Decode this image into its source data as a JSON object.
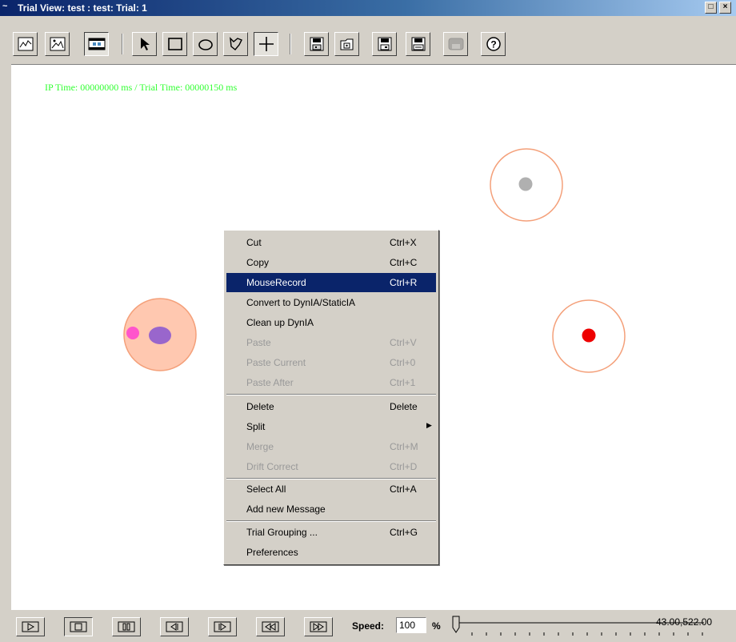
{
  "window": {
    "title": "Trial View: test : test: Trial: 1",
    "app_icon": "signal-wave-icon",
    "restore_glyph": "□",
    "close_glyph": "×"
  },
  "toolbar": {
    "tools": [
      {
        "name": "line-chart-icon"
      },
      {
        "name": "image-view-icon"
      },
      {
        "name": "animation-view-icon",
        "pressed": true
      },
      {
        "name": "pointer-icon"
      },
      {
        "name": "rectangle-icon"
      },
      {
        "name": "ellipse-icon"
      },
      {
        "name": "freehand-icon"
      },
      {
        "name": "crosshair-icon"
      },
      {
        "name": "save-ia-icon"
      },
      {
        "name": "open-ia-icon"
      },
      {
        "name": "save-ia-alt-icon"
      },
      {
        "name": "save-all-icon"
      },
      {
        "name": "disabled-tool-icon",
        "disabled": true
      },
      {
        "name": "help-icon"
      }
    ]
  },
  "canvas": {
    "time_label": "IP Time: 00000000 ms  /  Trial Time: 00000150 ms"
  },
  "context_menu": {
    "groups": [
      [
        {
          "label": "Cut",
          "shortcut": "Ctrl+X",
          "enabled": true
        },
        {
          "label": "Copy",
          "shortcut": "Ctrl+C",
          "enabled": true
        },
        {
          "label": "MouseRecord",
          "shortcut": "Ctrl+R",
          "enabled": true,
          "highlighted": true
        },
        {
          "label": "Convert to DynIA/StaticIA",
          "shortcut": "",
          "enabled": true
        },
        {
          "label": "Clean up DynIA",
          "shortcut": "",
          "enabled": true
        },
        {
          "label": "Paste",
          "shortcut": "Ctrl+V",
          "enabled": false
        },
        {
          "label": "Paste Current",
          "shortcut": "Ctrl+0",
          "enabled": false
        },
        {
          "label": "Paste After",
          "shortcut": "Ctrl+1",
          "enabled": false
        }
      ],
      [
        {
          "label": "Delete",
          "shortcut": "Delete",
          "enabled": true
        },
        {
          "label": "Split",
          "shortcut": "",
          "enabled": true,
          "submenu": true
        },
        {
          "label": "Merge",
          "shortcut": "Ctrl+M",
          "enabled": false
        },
        {
          "label": "Drift Correct",
          "shortcut": "Ctrl+D",
          "enabled": false
        }
      ],
      [
        {
          "label": "Select All",
          "shortcut": "Ctrl+A",
          "enabled": true
        },
        {
          "label": "Add new Message",
          "shortcut": "",
          "enabled": true
        }
      ],
      [
        {
          "label": "Trial Grouping ...",
          "shortcut": "Ctrl+G",
          "enabled": true
        },
        {
          "label": "Preferences",
          "shortcut": "",
          "enabled": true
        }
      ]
    ]
  },
  "playback": {
    "buttons": [
      {
        "name": "play-icon"
      },
      {
        "name": "stop-icon",
        "pressed": true
      },
      {
        "name": "pause-icon"
      },
      {
        "name": "step-back-icon"
      },
      {
        "name": "step-forward-icon"
      },
      {
        "name": "rewind-icon"
      },
      {
        "name": "fast-forward-icon"
      }
    ],
    "speed_label": "Speed:",
    "speed_value": "100",
    "speed_unit": "%",
    "coordinates": "43.00,522.00"
  },
  "colors": {
    "time_label": "#33ff33",
    "menu_highlight": "#0a246a",
    "ia_outline": "#f4a07a",
    "ia_fill": "#ffc8b0",
    "gaze_gray": "#b0b0b0",
    "gaze_red": "#ee0000",
    "gaze_purple": "#9966cc",
    "gaze_pink": "#ff55cc"
  }
}
